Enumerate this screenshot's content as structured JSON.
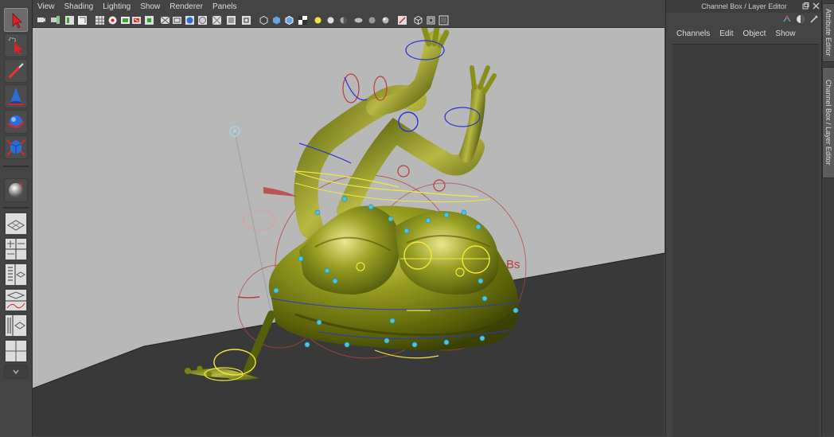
{
  "viewport": {
    "menus": [
      "View",
      "Shading",
      "Lighting",
      "Show",
      "Renderer",
      "Panels"
    ],
    "scene_label": "Bs"
  },
  "channel_box": {
    "title": "Channel Box / Layer Editor",
    "menus": [
      "Channels",
      "Edit",
      "Object",
      "Show"
    ]
  },
  "side_tabs": {
    "attribute_editor": "Attribute Editor",
    "channel_box": "Channel Box / Layer Editor"
  },
  "colors": {
    "ui_bg": "#444444",
    "floor": "#3a3a3a",
    "backdrop": "#b8b8b8",
    "frog_skin": "#8a8f1a",
    "ctrl_red": "#c0393b",
    "ctrl_blue": "#2a34d0",
    "ctrl_yellow": "#f0e83c",
    "joint_cyan": "#47c7e3"
  }
}
